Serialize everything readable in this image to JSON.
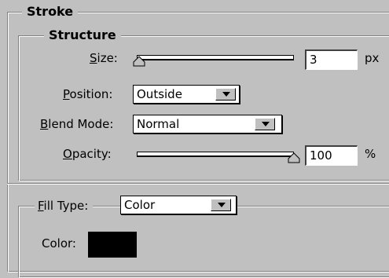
{
  "panel": {
    "legend": "Stroke"
  },
  "structure": {
    "legend": "Structure",
    "size": {
      "label": "Size:",
      "value": "3",
      "unit": "px",
      "slider_fraction": 0.02
    },
    "position": {
      "label": "Position:",
      "value": "Outside"
    },
    "blend_mode": {
      "label": "Blend Mode:",
      "value": "Normal"
    },
    "opacity": {
      "label": "Opacity:",
      "value": "100",
      "unit": "%",
      "slider_fraction": 1.0
    }
  },
  "fill": {
    "type_label": "Fill Type:",
    "type_value": "Color",
    "color_label": "Color:",
    "color_value": "#000000"
  },
  "colors": {
    "background": "#c0c0c0",
    "shadow": "#808080",
    "highlight": "#ffffff"
  }
}
